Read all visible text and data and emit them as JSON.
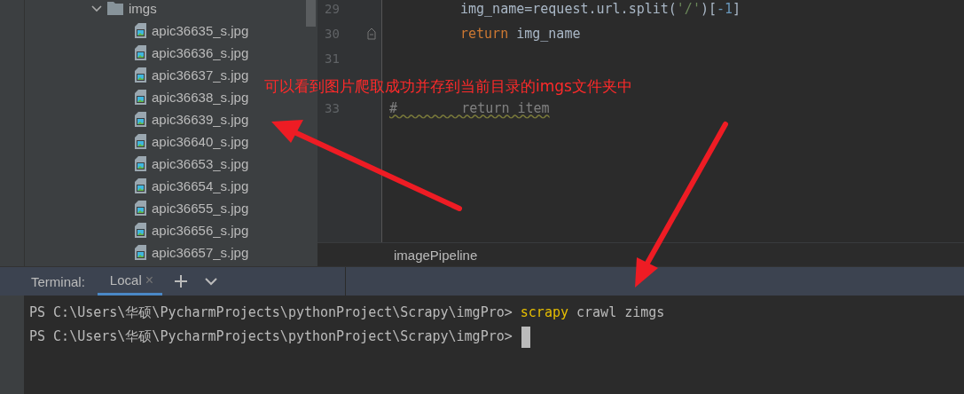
{
  "project_tree": {
    "folder": {
      "name": "imgs",
      "expanded": true
    },
    "files": [
      "apic36635_s.jpg",
      "apic36636_s.jpg",
      "apic36637_s.jpg",
      "apic36638_s.jpg",
      "apic36639_s.jpg",
      "apic36640_s.jpg",
      "apic36653_s.jpg",
      "apic36654_s.jpg",
      "apic36655_s.jpg",
      "apic36656_s.jpg",
      "apic36657_s.jpg"
    ]
  },
  "editor": {
    "lines": [
      {
        "number": "29",
        "kind": "indented",
        "tokens": [
          {
            "kind": "plain",
            "text": "img_name=request.url.split("
          },
          {
            "kind": "string",
            "text": "'/'"
          },
          {
            "kind": "plain",
            "text": ")["
          },
          {
            "kind": "number",
            "text": "-1"
          },
          {
            "kind": "plain",
            "text": "]"
          }
        ]
      },
      {
        "number": "30",
        "kind": "indented",
        "fold": true,
        "tokens": [
          {
            "kind": "keyword",
            "text": "return"
          },
          {
            "kind": "plain",
            "text": " img_name"
          }
        ]
      },
      {
        "number": "31",
        "kind": "blank"
      },
      {
        "kind": "blank"
      },
      {
        "number": "33",
        "kind": "flush",
        "tokens": [
          {
            "kind": "comment",
            "text": "#        return item"
          }
        ]
      }
    ],
    "breadcrumb": "imagePipeline"
  },
  "terminal": {
    "label": "Terminal:",
    "tabs": [
      {
        "label": "Local",
        "selected": true,
        "close": "×"
      }
    ],
    "lines": [
      {
        "prompt": "PS C:\\Users\\华硕\\PycharmProjects\\pythonProject\\Scrapy\\imgPro>",
        "command": "scrapy",
        "args": " crawl zimgs",
        "cursor": false
      },
      {
        "prompt": "PS C:\\Users\\华硕\\PycharmProjects\\pythonProject\\Scrapy\\imgPro>",
        "cursor": true
      }
    ]
  },
  "annotation": {
    "text": "可以看到图片爬取成功并存到当前目录的imgs文件夹中"
  }
}
